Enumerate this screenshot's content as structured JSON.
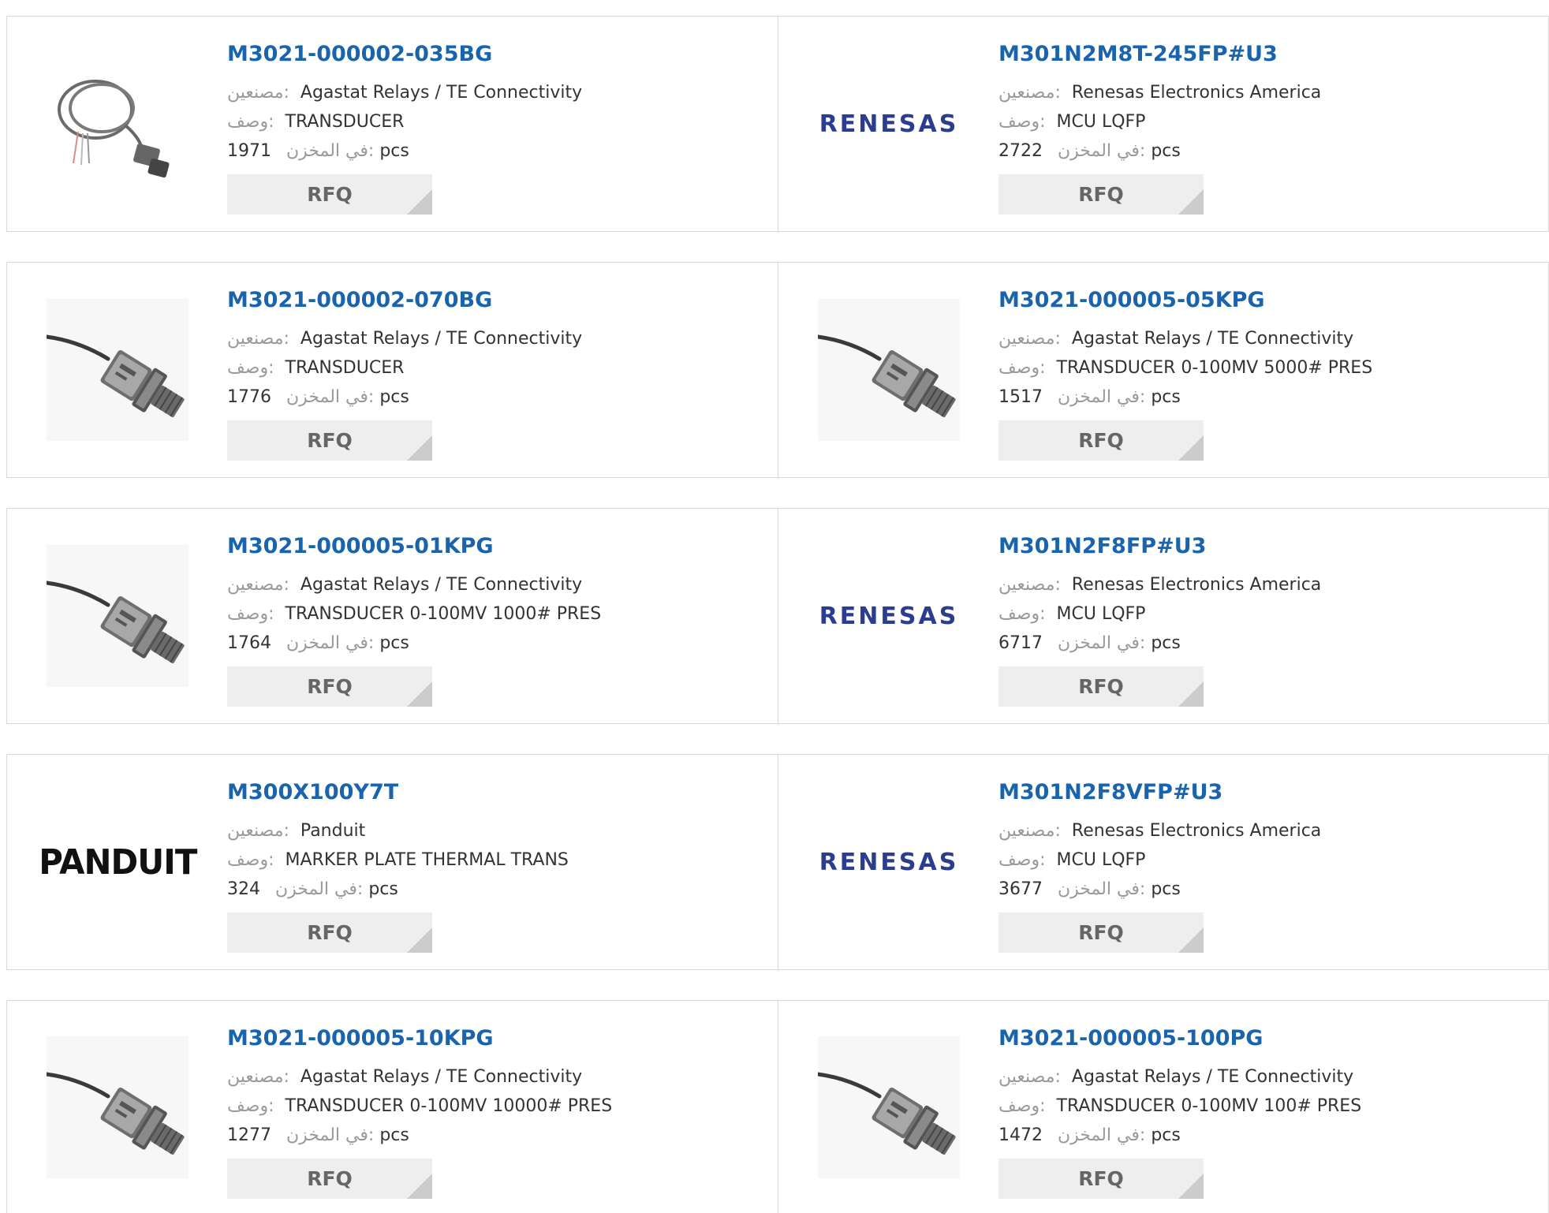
{
  "labels": {
    "manufacturer": "مصنعين:",
    "description": "وصف:",
    "stock": "في المخزن:",
    "unit": "pcs",
    "rfq": "RFQ"
  },
  "brand_logos": {
    "renesas": "RENESAS",
    "panduit": "PANDUIT"
  },
  "products": [
    {
      "part_number": "M3021-000002-035BG",
      "manufacturer": "Agastat Relays / TE Connectivity",
      "description": "TRANSDUCER",
      "stock": "1971",
      "image": "coiled-sensor-image"
    },
    {
      "part_number": "M301N2M8T-245FP#U3",
      "manufacturer": "Renesas Electronics America",
      "description": "MCU LQFP",
      "stock": "2722",
      "image": "renesas-logo"
    },
    {
      "part_number": "M3021-000002-070BG",
      "manufacturer": "Agastat Relays / TE Connectivity",
      "description": "TRANSDUCER",
      "stock": "1776",
      "image": "pressure-sensor-image"
    },
    {
      "part_number": "M3021-000005-05KPG",
      "manufacturer": "Agastat Relays / TE Connectivity",
      "description": "TRANSDUCER 0-100MV 5000# PRES",
      "stock": "1517",
      "image": "pressure-sensor-image"
    },
    {
      "part_number": "M3021-000005-01KPG",
      "manufacturer": "Agastat Relays / TE Connectivity",
      "description": "TRANSDUCER 0-100MV 1000# PRES",
      "stock": "1764",
      "image": "pressure-sensor-image"
    },
    {
      "part_number": "M301N2F8FP#U3",
      "manufacturer": "Renesas Electronics America",
      "description": "MCU LQFP",
      "stock": "6717",
      "image": "renesas-logo"
    },
    {
      "part_number": "M300X100Y7T",
      "manufacturer": "Panduit",
      "description": "MARKER PLATE THERMAL TRANS",
      "stock": "324",
      "image": "panduit-logo"
    },
    {
      "part_number": "M301N2F8VFP#U3",
      "manufacturer": "Renesas Electronics America",
      "description": "MCU LQFP",
      "stock": "3677",
      "image": "renesas-logo"
    },
    {
      "part_number": "M3021-000005-10KPG",
      "manufacturer": "Agastat Relays / TE Connectivity",
      "description": "TRANSDUCER 0-100MV 10000# PRES",
      "stock": "1277",
      "image": "pressure-sensor-image"
    },
    {
      "part_number": "M3021-000005-100PG",
      "manufacturer": "Agastat Relays / TE Connectivity",
      "description": "TRANSDUCER 0-100MV 100# PRES",
      "stock": "1472",
      "image": "pressure-sensor-image"
    }
  ]
}
